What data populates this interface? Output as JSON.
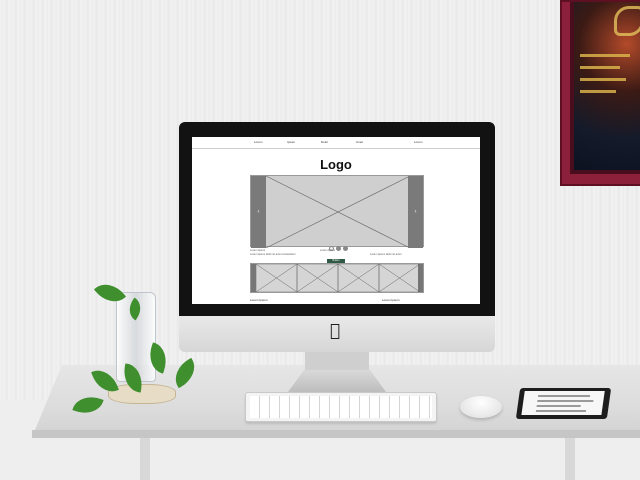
{
  "scene": {
    "screen": {
      "nav_items": [
        "Lorem",
        "Ipsum",
        "Dolor",
        "Amet",
        "Lorem"
      ],
      "logo_text": "Logo",
      "button_label": "Button",
      "footer_labels": [
        "Lorem Ipsum",
        "Lorem Ipsum"
      ],
      "row_texts": [
        "Lorem  Ipsum",
        "Lorem  Ipsum",
        "Lorem  Ipsum dolor sit amet consectetur",
        "Lorem  Ipsum dolor sit amet"
      ],
      "slider_prev_icon": "chevron-left-icon",
      "slider_next_icon": "chevron-right-icon"
    },
    "colors": {
      "frame": "#8c1f3a",
      "screen_button": "#2e5a43",
      "plant_leaf": "#3f8f2e"
    }
  }
}
